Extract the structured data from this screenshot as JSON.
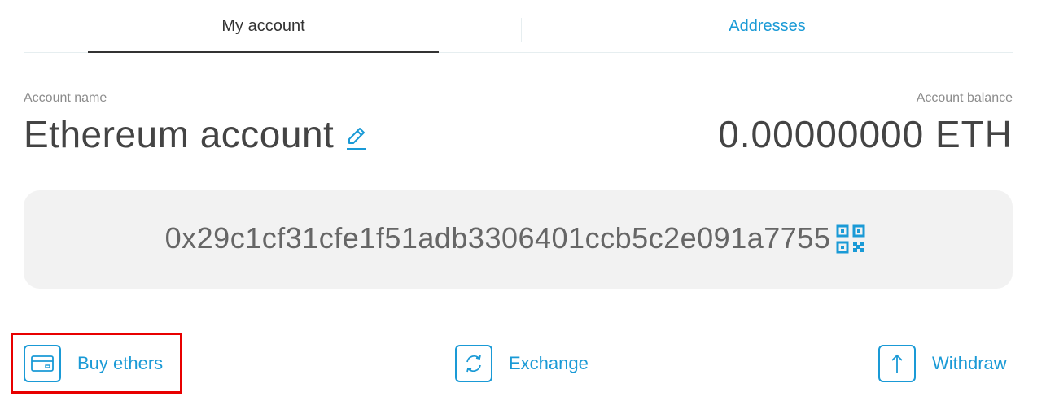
{
  "tabs": [
    {
      "label": "My account",
      "active": true
    },
    {
      "label": "Addresses",
      "active": false
    }
  ],
  "account": {
    "name_label": "Account name",
    "name": "Ethereum account",
    "balance_label": "Account balance",
    "balance": "0.00000000 ETH"
  },
  "address": {
    "value": "0x29c1cf31cfe1f51adb3306401ccb5c2e091a7755"
  },
  "actions": {
    "buy_label": "Buy ethers",
    "exchange_label": "Exchange",
    "withdraw_label": "Withdraw"
  },
  "icons": {
    "edit": "pencil-icon",
    "qr": "qr-code-icon",
    "buy": "credit-card-icon",
    "exchange": "refresh-icon",
    "withdraw": "arrow-up-icon"
  },
  "colors": {
    "accent": "#1a9ad6",
    "highlight": "#e80000",
    "address_bg": "#f2f2f2"
  }
}
